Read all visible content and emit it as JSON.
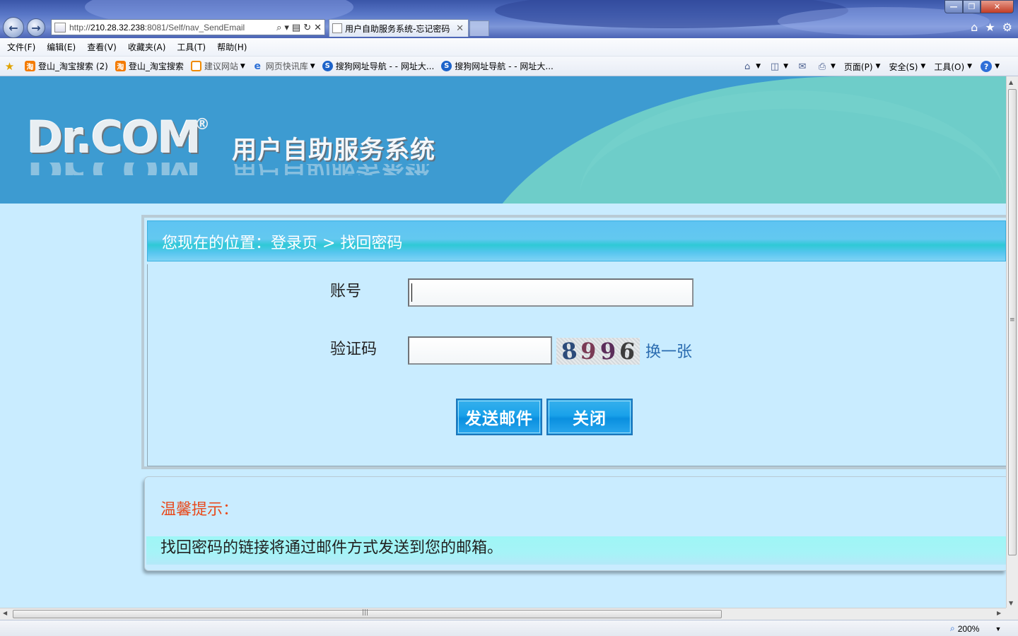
{
  "browser": {
    "url_prefix": "http://",
    "url_host": "210.28.32.238",
    "url_rest": ":8081/Self/nav_SendEmail",
    "tab_title": "用户自助服务系统-忘记密码",
    "menu": [
      "文件(F)",
      "编辑(E)",
      "查看(V)",
      "收藏夹(A)",
      "工具(T)",
      "帮助(H)"
    ],
    "favorites": [
      {
        "label": "登山_淘宝搜索 (2)"
      },
      {
        "label": "登山_淘宝搜索"
      },
      {
        "label": "建议网站"
      },
      {
        "label": "网页快讯库"
      },
      {
        "label": "搜狗网址导航 - - 网址大..."
      },
      {
        "label": "搜狗网址导航 - - 网址大..."
      }
    ],
    "commands": {
      "page": "页面(P)",
      "safety": "安全(S)",
      "tools": "工具(O)"
    },
    "zoom": "200%"
  },
  "banner": {
    "logo": "Dr.COM",
    "logo_mark": "®",
    "system_title": "用户自助服务系统"
  },
  "form": {
    "breadcrumb": "您现在的位置：登录页 > 找回密码",
    "account_label": "账号",
    "account_value": "",
    "captcha_label": "验证码",
    "captcha_value": "",
    "captcha_digits": [
      "8",
      "9",
      "9",
      "6"
    ],
    "refresh_link": "换一张",
    "send_button": "发送邮件",
    "close_button": "关闭"
  },
  "tip": {
    "title": "温馨提示：",
    "body": "找回密码的链接将通过邮件方式发送到您的邮箱。"
  }
}
